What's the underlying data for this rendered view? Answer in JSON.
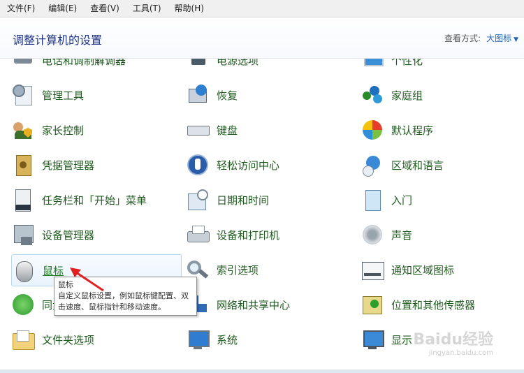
{
  "menu": [
    "文件(F)",
    "编辑(E)",
    "查看(V)",
    "工具(T)",
    "帮助(H)"
  ],
  "header": {
    "title": "调整计算机的设置",
    "view_by_label": "查看方式:",
    "view_by_value": "大图标"
  },
  "columns": [
    [
      {
        "label": "电话和调制解调器",
        "icon": "phone-modem-icon",
        "partial": true
      },
      {
        "label": "管理工具",
        "icon": "admin-tools-icon"
      },
      {
        "label": "家长控制",
        "icon": "parental-control-icon"
      },
      {
        "label": "凭据管理器",
        "icon": "credential-manager-icon"
      },
      {
        "label": "任务栏和「开始」菜单",
        "icon": "taskbar-icon"
      },
      {
        "label": "设备管理器",
        "icon": "device-manager-icon"
      },
      {
        "label": "鼠标",
        "icon": "mouse-icon",
        "hover": true
      },
      {
        "label": "同步中心",
        "icon": "sync-center-icon"
      },
      {
        "label": "文件夹选项",
        "icon": "folder-options-icon"
      }
    ],
    [
      {
        "label": "电源选项",
        "icon": "power-options-icon",
        "partial": true
      },
      {
        "label": "恢复",
        "icon": "recovery-icon"
      },
      {
        "label": "键盘",
        "icon": "keyboard-icon"
      },
      {
        "label": "轻松访问中心",
        "icon": "ease-of-access-icon"
      },
      {
        "label": "日期和时间",
        "icon": "date-time-icon"
      },
      {
        "label": "设备和打印机",
        "icon": "printer-icon"
      },
      {
        "label": "索引选项",
        "icon": "indexing-icon"
      },
      {
        "label": "网络和共享中心",
        "icon": "network-icon"
      },
      {
        "label": "系统",
        "icon": "system-icon"
      }
    ],
    [
      {
        "label": "个性化",
        "icon": "personalization-icon",
        "partial": true
      },
      {
        "label": "家庭组",
        "icon": "homegroup-icon"
      },
      {
        "label": "默认程序",
        "icon": "default-programs-icon"
      },
      {
        "label": "区域和语言",
        "icon": "region-language-icon"
      },
      {
        "label": "入门",
        "icon": "getting-started-icon"
      },
      {
        "label": "声音",
        "icon": "sound-icon"
      },
      {
        "label": "通知区域图标",
        "icon": "notification-area-icon"
      },
      {
        "label": "位置和其他传感器",
        "icon": "location-sensors-icon"
      },
      {
        "label": "显示",
        "icon": "display-icon"
      }
    ]
  ],
  "tooltip": {
    "title": "鼠标",
    "text": "自定义鼠标设置，例如鼠标键配置、双击速度、鼠标指针和移动速度。"
  },
  "watermark": {
    "brand": "Baidu经验",
    "url": "jingyan.baidu.com"
  },
  "colors": {
    "link_green": "#1e5a1e",
    "title_blue": "#1e3287",
    "hover_bg": "#e9f3fd",
    "arrow_red": "#e02020"
  }
}
